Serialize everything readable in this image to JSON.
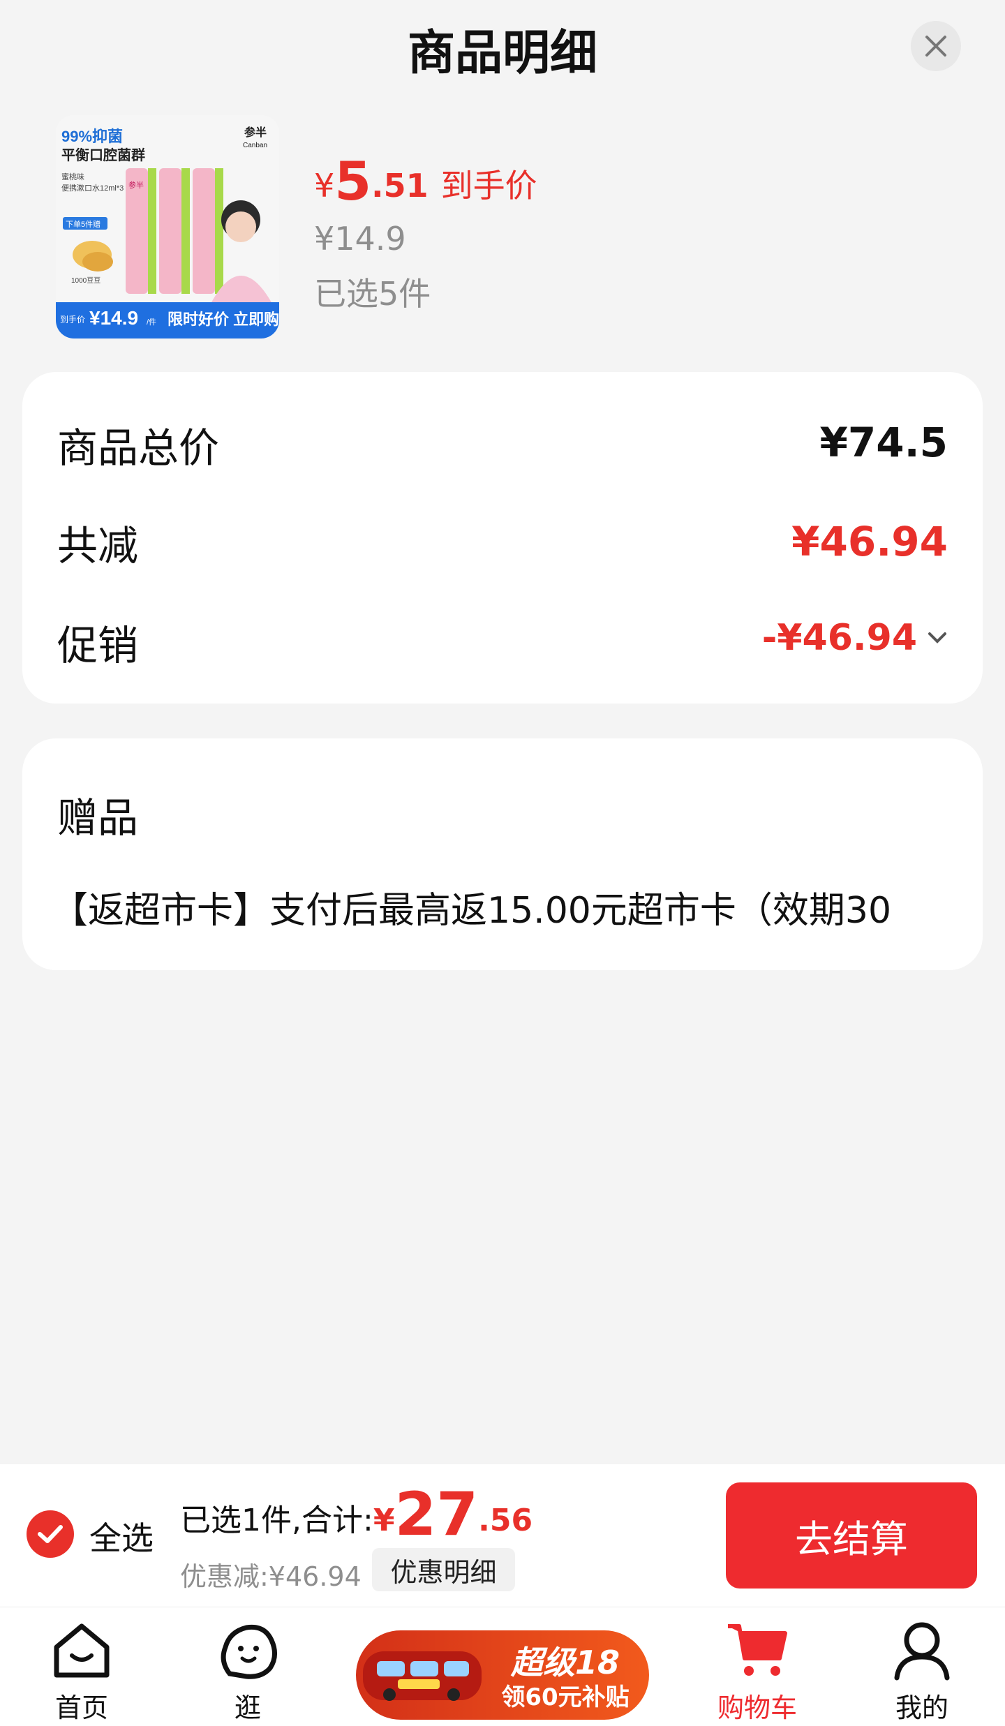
{
  "header": {
    "title": "商品明细"
  },
  "product": {
    "image": {
      "headline": "99%抑菌",
      "subline": "平衡口腔菌群",
      "brand": "参半",
      "brand_en": "Canban",
      "flavor": "蜜桃味",
      "spec": "便携漱口水12ml*3",
      "tag": "下单5件赠",
      "gift": "1000豆豆",
      "bottle_brand": "参半",
      "banner_prefix": "到手价",
      "banner_price": "¥14.9",
      "banner_unit": "/件",
      "banner_text": "限时好价 立即购"
    },
    "price_symbol": "¥",
    "price_int": "5",
    "price_dec": ".51",
    "price_label": "到手价",
    "original_price": "¥14.9",
    "selected_qty": "已选5件"
  },
  "summary_card": {
    "total_label": "商品总价",
    "total_value": "¥74.5",
    "reduce_label": "共减",
    "reduce_value": "¥46.94",
    "promo_label": "促销",
    "promo_value": "-¥46.94"
  },
  "gift_card": {
    "title": "赠品",
    "text": "【返超市卡】支付后最高返15.00元超市卡（效期30"
  },
  "footer": {
    "select_all": "全选",
    "summary_prefix": "已选1件,合计:",
    "total_symbol": "¥",
    "total_int": "27",
    "total_dec": ".56",
    "discount": "优惠减:¥46.94",
    "detail_button": "优惠明细",
    "checkout_button": "去结算"
  },
  "nav": {
    "home": "首页",
    "browse": "逛",
    "promo_title": "超级18",
    "promo_sub": "领60元补贴",
    "cart": "购物车",
    "mine": "我的"
  },
  "colors": {
    "accent": "#e8302a",
    "checkout": "#ee2b2f",
    "muted": "#8e8e8e"
  }
}
